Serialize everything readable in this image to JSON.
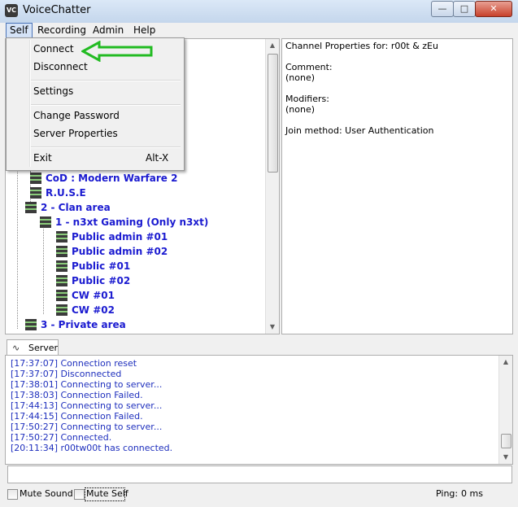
{
  "window": {
    "title": "VoiceChatter",
    "app_icon": "VC"
  },
  "menubar": {
    "items": [
      {
        "label": "Self"
      },
      {
        "label": "Recording"
      },
      {
        "label": "Admin"
      },
      {
        "label": "Help"
      }
    ]
  },
  "self_menu": {
    "connect": "Connect",
    "disconnect": "Disconnect",
    "settings": "Settings",
    "change_password": "Change Password",
    "server_properties": "Server Properties",
    "exit": "Exit",
    "exit_shortcut": "Alt-X"
  },
  "tree": {
    "items": [
      {
        "label": "CoD : Modern Warfare 2"
      },
      {
        "label": "R.U.S.E"
      },
      {
        "label": "2 - Clan area"
      },
      {
        "label": "1 - n3xt Gaming (Only n3xt)"
      },
      {
        "label": "Public admin #01"
      },
      {
        "label": "Public admin #02"
      },
      {
        "label": "Public #01"
      },
      {
        "label": "Public #02"
      },
      {
        "label": "CW #01"
      },
      {
        "label": "CW #02"
      },
      {
        "label": "3 - Private area"
      }
    ]
  },
  "properties": {
    "header": "Channel Properties for: r00t & zEu",
    "comment_label": "Comment:",
    "comment_value": "(none)",
    "modifiers_label": "Modifiers:",
    "modifiers_value": "(none)",
    "join_method": "Join method: User Authentication"
  },
  "tabs": {
    "server": "Server"
  },
  "log": {
    "lines": [
      "[17:37:07] Connection reset",
      "[17:37:07] Disconnected",
      "[17:38:01] Connecting to server...",
      "[17:38:03] Connection Failed.",
      "[17:44:13] Connecting to server...",
      "[17:44:15] Connection Failed.",
      "[17:50:27] Connecting to server...",
      "[17:50:27] Connected.",
      "[20:11:34] r00tw00t has connected."
    ]
  },
  "status": {
    "mute_sound": "Mute Sound",
    "mute_self": "Mute Self",
    "ping": "Ping:",
    "ping_value": "0 ms"
  },
  "colors": {
    "tree_text": "#1b1bd0",
    "log_text": "#1e2fbd",
    "annotation_arrow": "#22bb22"
  }
}
